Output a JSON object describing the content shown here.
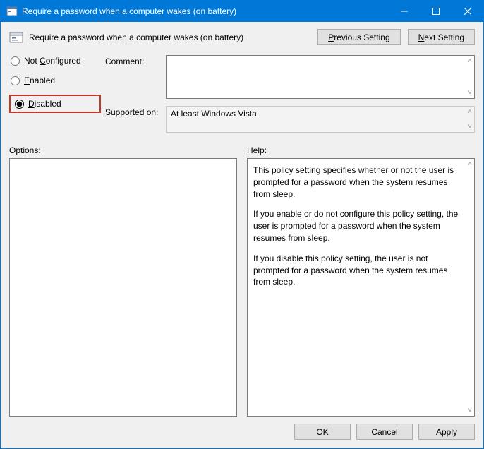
{
  "window": {
    "title": "Require a password when a computer wakes (on battery)"
  },
  "header": {
    "policy_title": "Require a password when a computer wakes (on battery)",
    "prev_button": "Previous Setting",
    "next_button": "Next Setting"
  },
  "state_options": {
    "not_configured": "Not Configured",
    "enabled": "Enabled",
    "disabled": "Disabled",
    "selected": "disabled"
  },
  "fields": {
    "comment_label": "Comment:",
    "comment_value": "",
    "supported_label": "Supported on:",
    "supported_value": "At least Windows Vista"
  },
  "panes": {
    "options_label": "Options:",
    "help_label": "Help:",
    "help_paragraphs": [
      "This policy setting specifies whether or not the user is prompted for a password when the system resumes from sleep.",
      "If you enable or do not configure this policy setting, the user is prompted for a password when the system resumes from sleep.",
      "If you disable this policy setting, the user is not prompted for a password when the system resumes from sleep."
    ]
  },
  "footer": {
    "ok": "OK",
    "cancel": "Cancel",
    "apply": "Apply"
  }
}
